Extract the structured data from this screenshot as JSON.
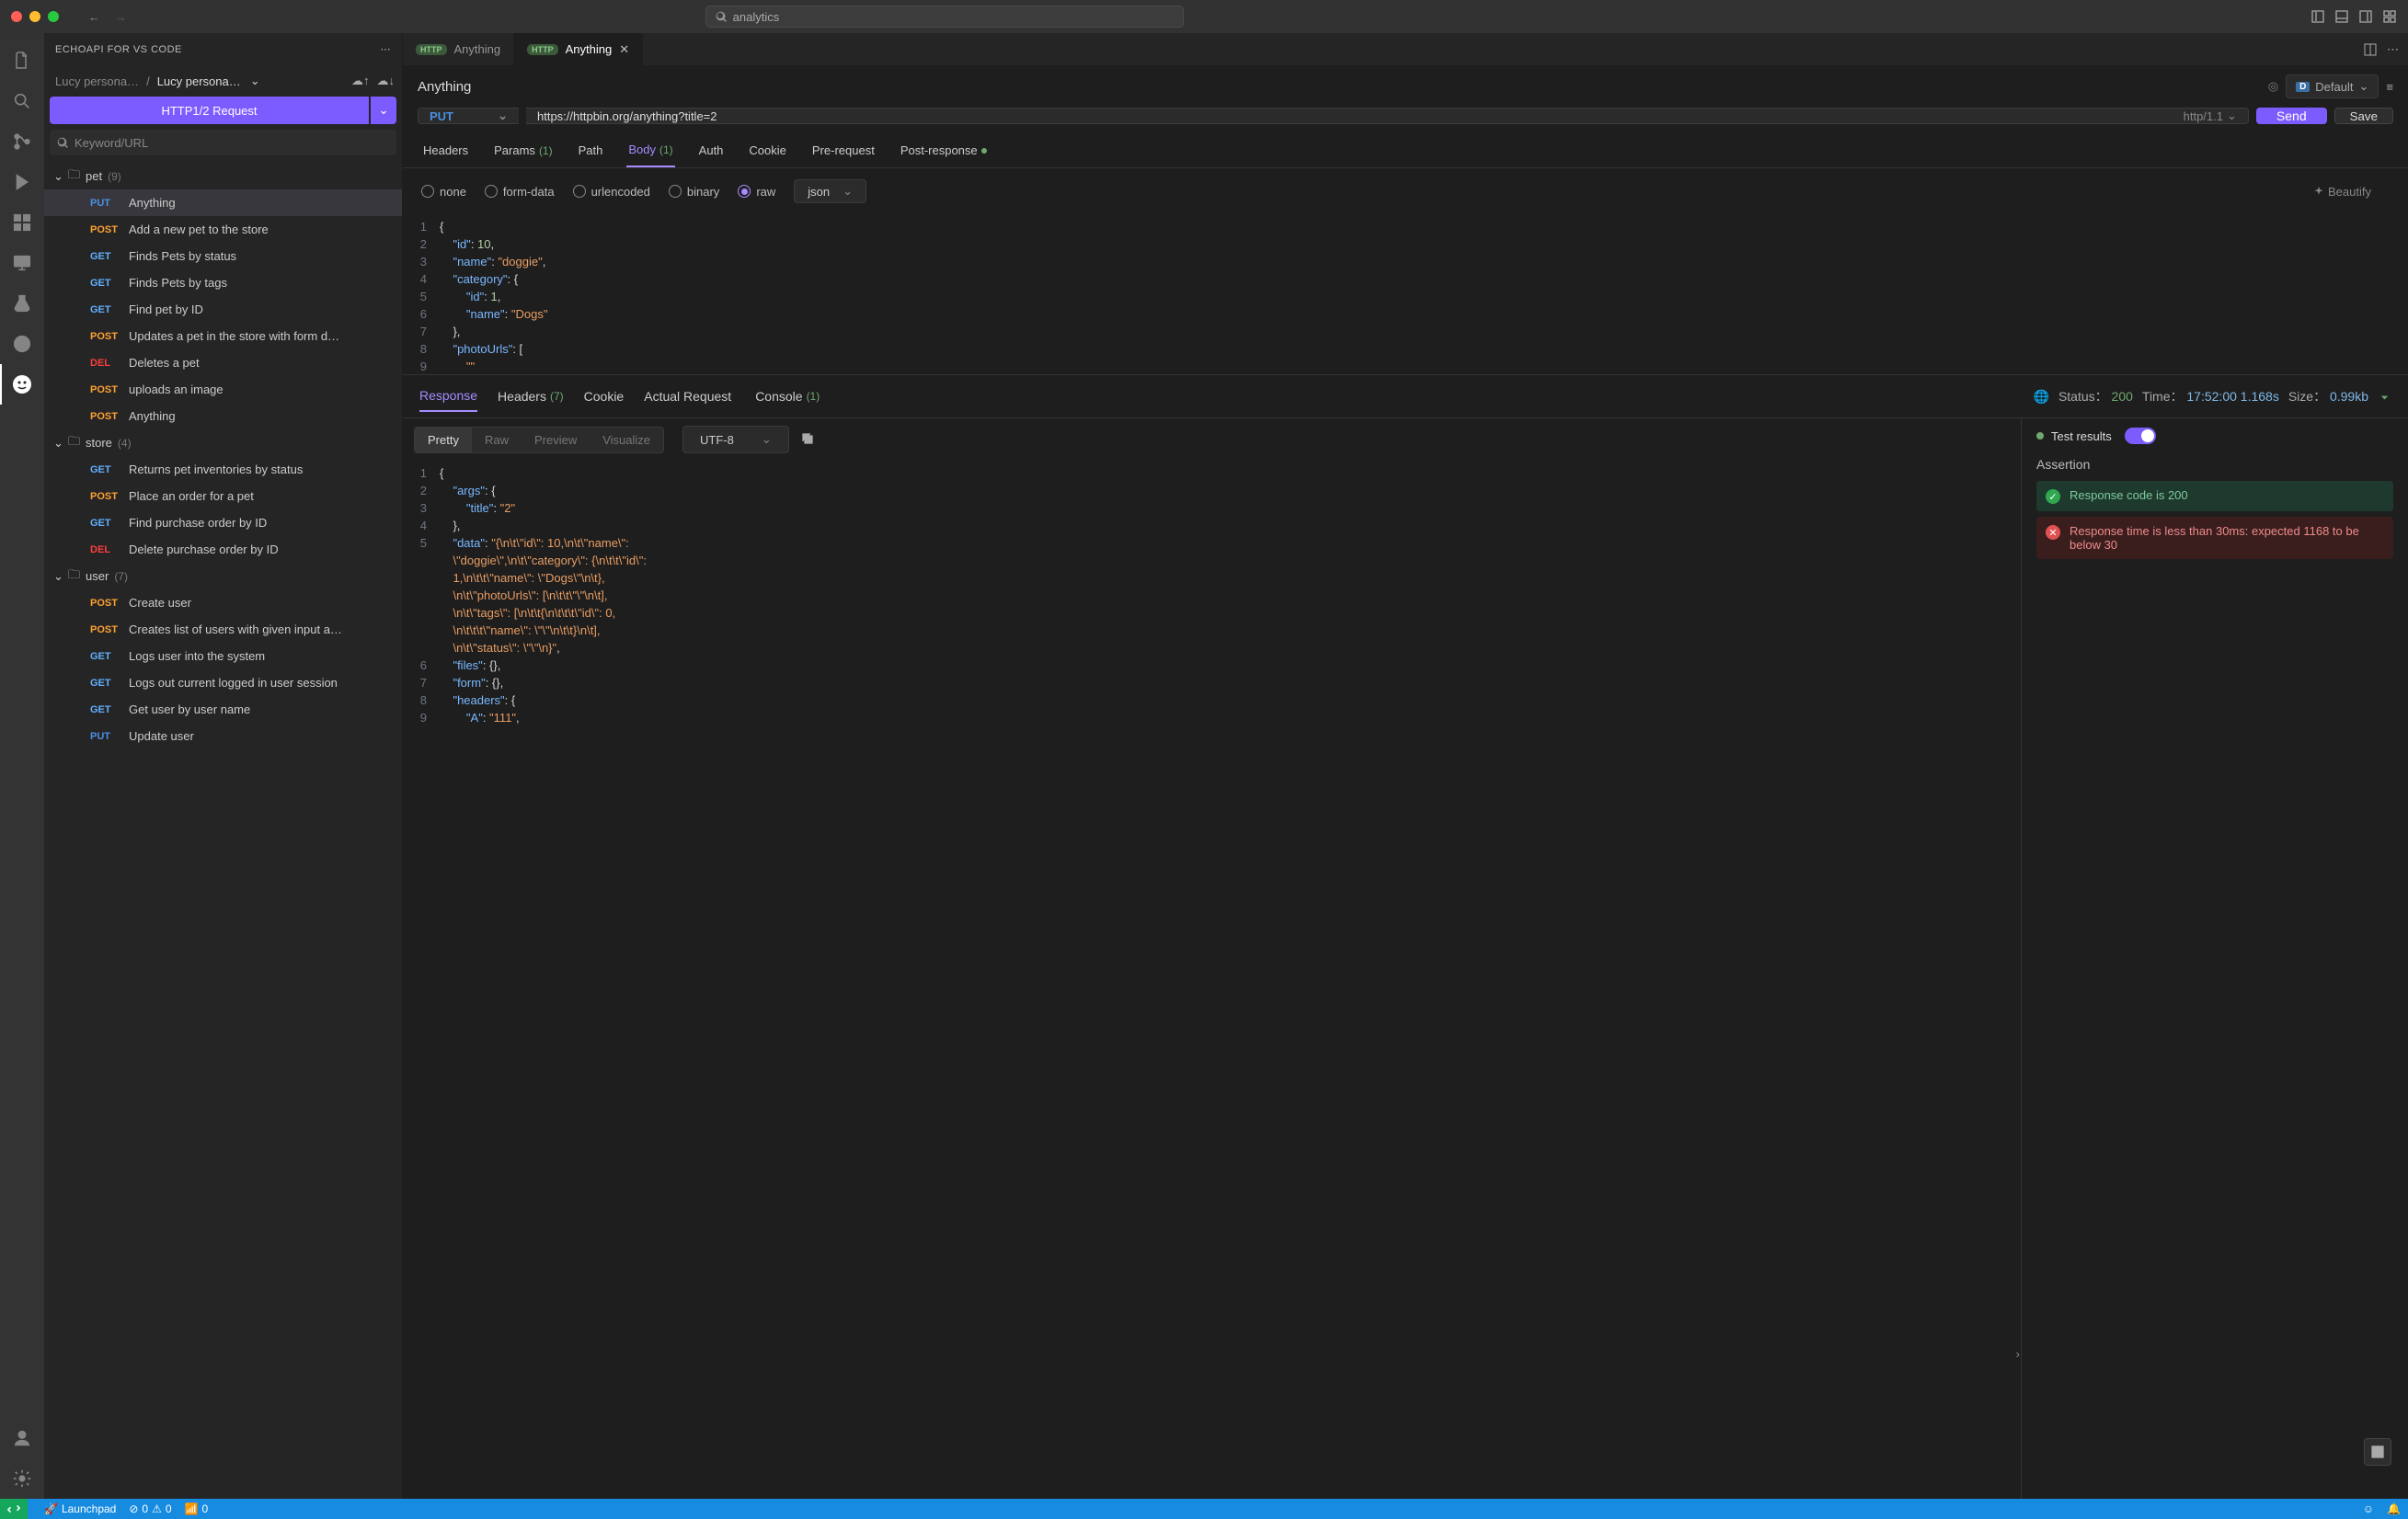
{
  "titlebar": {
    "search": "analytics"
  },
  "sidebar": {
    "title": "ECHOAPI FOR VS CODE",
    "crumb1": "Lucy persona…",
    "crumb2": "Lucy persona…",
    "requestBtn": "HTTP1/2 Request",
    "searchPlaceholder": "Keyword/URL",
    "folders": [
      {
        "name": "pet",
        "count": "(9)",
        "open": true,
        "items": [
          {
            "method": "PUT",
            "m": "m-put",
            "label": "Anything",
            "sel": true
          },
          {
            "method": "POST",
            "m": "m-post",
            "label": "Add a new pet to the store"
          },
          {
            "method": "GET",
            "m": "m-get",
            "label": "Finds Pets by status"
          },
          {
            "method": "GET",
            "m": "m-get",
            "label": "Finds Pets by tags"
          },
          {
            "method": "GET",
            "m": "m-get",
            "label": "Find pet by ID"
          },
          {
            "method": "POST",
            "m": "m-post",
            "label": "Updates a pet in the store with form d…"
          },
          {
            "method": "DEL",
            "m": "m-del",
            "label": "Deletes a pet"
          },
          {
            "method": "POST",
            "m": "m-post",
            "label": "uploads an image"
          },
          {
            "method": "POST",
            "m": "m-post",
            "label": "Anything"
          }
        ]
      },
      {
        "name": "store",
        "count": "(4)",
        "open": true,
        "items": [
          {
            "method": "GET",
            "m": "m-get",
            "label": "Returns pet inventories by status"
          },
          {
            "method": "POST",
            "m": "m-post",
            "label": "Place an order for a pet"
          },
          {
            "method": "GET",
            "m": "m-get",
            "label": "Find purchase order by ID"
          },
          {
            "method": "DEL",
            "m": "m-del",
            "label": "Delete purchase order by ID"
          }
        ]
      },
      {
        "name": "user",
        "count": "(7)",
        "open": true,
        "items": [
          {
            "method": "POST",
            "m": "m-post",
            "label": "Create user"
          },
          {
            "method": "POST",
            "m": "m-post",
            "label": "Creates list of users with given input a…"
          },
          {
            "method": "GET",
            "m": "m-get",
            "label": "Logs user into the system"
          },
          {
            "method": "GET",
            "m": "m-get",
            "label": "Logs out current logged in user session"
          },
          {
            "method": "GET",
            "m": "m-get",
            "label": "Get user by user name"
          },
          {
            "method": "PUT",
            "m": "m-put",
            "label": "Update user"
          }
        ]
      }
    ]
  },
  "tabs": [
    {
      "label": "Anything",
      "active": false
    },
    {
      "label": "Anything",
      "active": true
    }
  ],
  "request": {
    "name": "Anything",
    "env": "Default",
    "method": "PUT",
    "url": "https://httpbin.org/anything?title=2",
    "proto": "http/1.1",
    "sendLabel": "Send",
    "saveLabel": "Save",
    "tabs": {
      "headers": "Headers",
      "params": "Params",
      "paramsBadge": "(1)",
      "path": "Path",
      "body": "Body",
      "bodyBadge": "(1)",
      "auth": "Auth",
      "cookie": "Cookie",
      "pre": "Pre-request",
      "post": "Post-response"
    },
    "bodyModes": {
      "none": "none",
      "form": "form-data",
      "url": "urlencoded",
      "bin": "binary",
      "raw": "raw"
    },
    "rawType": "json",
    "beautify": "Beautify"
  },
  "requestBodyLines": [
    [
      {
        "t": "{",
        "c": "p"
      }
    ],
    [
      {
        "t": "    ",
        "c": "p"
      },
      {
        "t": "\"id\"",
        "c": "k"
      },
      {
        "t": ": ",
        "c": "p"
      },
      {
        "t": "10",
        "c": "n"
      },
      {
        "t": ",",
        "c": "p"
      }
    ],
    [
      {
        "t": "    ",
        "c": "p"
      },
      {
        "t": "\"name\"",
        "c": "k"
      },
      {
        "t": ": ",
        "c": "p"
      },
      {
        "t": "\"doggie\"",
        "c": "s"
      },
      {
        "t": ",",
        "c": "p"
      }
    ],
    [
      {
        "t": "    ",
        "c": "p"
      },
      {
        "t": "\"category\"",
        "c": "k"
      },
      {
        "t": ": {",
        "c": "p"
      }
    ],
    [
      {
        "t": "        ",
        "c": "p"
      },
      {
        "t": "\"id\"",
        "c": "k"
      },
      {
        "t": ": ",
        "c": "p"
      },
      {
        "t": "1",
        "c": "n"
      },
      {
        "t": ",",
        "c": "p"
      }
    ],
    [
      {
        "t": "        ",
        "c": "p"
      },
      {
        "t": "\"name\"",
        "c": "k"
      },
      {
        "t": ": ",
        "c": "p"
      },
      {
        "t": "\"Dogs\"",
        "c": "s"
      }
    ],
    [
      {
        "t": "    },",
        "c": "p"
      }
    ],
    [
      {
        "t": "    ",
        "c": "p"
      },
      {
        "t": "\"photoUrls\"",
        "c": "k"
      },
      {
        "t": ": [",
        "c": "p"
      }
    ],
    [
      {
        "t": "        ",
        "c": "p"
      },
      {
        "t": "\"\"",
        "c": "s"
      }
    ]
  ],
  "response": {
    "tabs": {
      "response": "Response",
      "headers": "Headers",
      "headersBadge": "(7)",
      "cookie": "Cookie",
      "actual": "Actual Request",
      "console": "Console",
      "consoleBadge": "(1)"
    },
    "statusLabel": "Status：",
    "statusCode": "200",
    "timeLabel": "Time：",
    "timeStamp": "17:52:00",
    "duration": "1.168s",
    "sizeLabel": "Size：",
    "size": "0.99kb",
    "views": {
      "pretty": "Pretty",
      "raw": "Raw",
      "preview": "Preview",
      "visualize": "Visualize"
    },
    "encoding": "UTF-8",
    "testResults": "Test results",
    "assertionTitle": "Assertion",
    "assertions": [
      {
        "ok": true,
        "msg": "Response code is 200"
      },
      {
        "ok": false,
        "msg": "Response time is less than 30ms: expected 1168 to be below 30"
      }
    ]
  },
  "responseBodyLines": [
    {
      "n": "1",
      "seg": [
        {
          "t": "{",
          "c": "p"
        }
      ]
    },
    {
      "n": "2",
      "seg": [
        {
          "t": "    ",
          "c": "p"
        },
        {
          "t": "\"args\"",
          "c": "k"
        },
        {
          "t": ": {",
          "c": "p"
        }
      ]
    },
    {
      "n": "3",
      "seg": [
        {
          "t": "        ",
          "c": "p"
        },
        {
          "t": "\"title\"",
          "c": "k"
        },
        {
          "t": ": ",
          "c": "p"
        },
        {
          "t": "\"2\"",
          "c": "s"
        }
      ]
    },
    {
      "n": "4",
      "seg": [
        {
          "t": "    },",
          "c": "p"
        }
      ]
    },
    {
      "n": "5",
      "seg": [
        {
          "t": "    ",
          "c": "p"
        },
        {
          "t": "\"data\"",
          "c": "k"
        },
        {
          "t": ": ",
          "c": "p"
        },
        {
          "t": "\"{\\n\\t\\\"id\\\": 10,\\n\\t\\\"name\\\": ",
          "c": "s"
        }
      ]
    },
    {
      "n": "",
      "seg": [
        {
          "t": "    ",
          "c": "p"
        },
        {
          "t": "\\\"doggie\\\",\\n\\t\\\"category\\\": {\\n\\t\\t\\\"id\\\": ",
          "c": "s"
        }
      ]
    },
    {
      "n": "",
      "seg": [
        {
          "t": "    ",
          "c": "p"
        },
        {
          "t": "1,\\n\\t\\t\\\"name\\\": \\\"Dogs\\\"\\n\\t},",
          "c": "s"
        }
      ]
    },
    {
      "n": "",
      "seg": [
        {
          "t": "    ",
          "c": "p"
        },
        {
          "t": "\\n\\t\\\"photoUrls\\\": [\\n\\t\\t\\\"\\\"\\n\\t],",
          "c": "s"
        }
      ]
    },
    {
      "n": "",
      "seg": [
        {
          "t": "    ",
          "c": "p"
        },
        {
          "t": "\\n\\t\\\"tags\\\": [\\n\\t\\t{\\n\\t\\t\\t\\\"id\\\": 0,",
          "c": "s"
        }
      ]
    },
    {
      "n": "",
      "seg": [
        {
          "t": "    ",
          "c": "p"
        },
        {
          "t": "\\n\\t\\t\\t\\\"name\\\": \\\"\\\"\\n\\t\\t}\\n\\t],",
          "c": "s"
        }
      ]
    },
    {
      "n": "",
      "seg": [
        {
          "t": "    ",
          "c": "p"
        },
        {
          "t": "\\n\\t\\\"status\\\": \\\"\\\"\\n}\"",
          "c": "s"
        },
        {
          "t": ",",
          "c": "p"
        }
      ]
    },
    {
      "n": "6",
      "seg": [
        {
          "t": "    ",
          "c": "p"
        },
        {
          "t": "\"files\"",
          "c": "k"
        },
        {
          "t": ": {},",
          "c": "p"
        }
      ]
    },
    {
      "n": "7",
      "seg": [
        {
          "t": "    ",
          "c": "p"
        },
        {
          "t": "\"form\"",
          "c": "k"
        },
        {
          "t": ": {},",
          "c": "p"
        }
      ]
    },
    {
      "n": "8",
      "seg": [
        {
          "t": "    ",
          "c": "p"
        },
        {
          "t": "\"headers\"",
          "c": "k"
        },
        {
          "t": ": {",
          "c": "p"
        }
      ]
    },
    {
      "n": "9",
      "seg": [
        {
          "t": "        ",
          "c": "p"
        },
        {
          "t": "\"A\"",
          "c": "k"
        },
        {
          "t": ": ",
          "c": "p"
        },
        {
          "t": "\"111\"",
          "c": "s"
        },
        {
          "t": ",",
          "c": "p"
        }
      ]
    }
  ],
  "statusbar": {
    "launchpad": "Launchpad",
    "errors": "0",
    "warnings": "0",
    "port": "0"
  }
}
